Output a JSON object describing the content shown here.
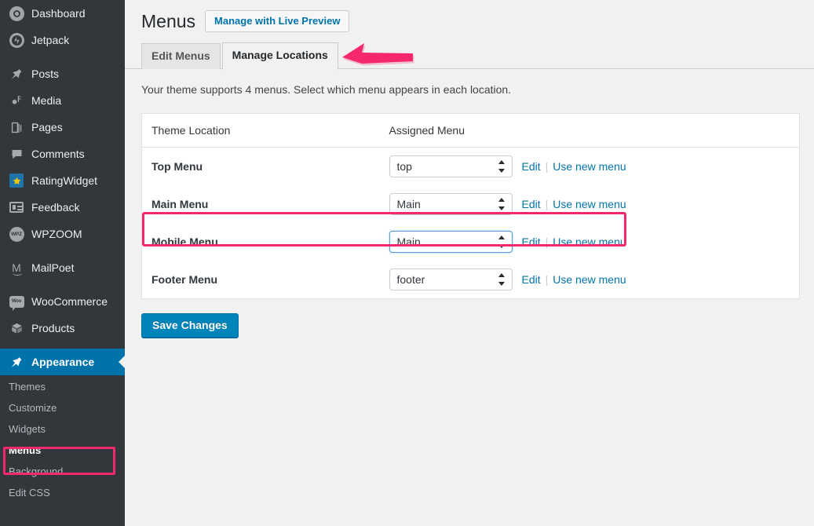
{
  "colors": {
    "sidebar_bg": "#32373c",
    "accent_blue": "#0073aa",
    "highlight_pink": "#f4286b",
    "link_blue": "#0073aa",
    "button_blue": "#0085ba"
  },
  "sidebar": {
    "groups": [
      {
        "items": [
          {
            "label": "Dashboard",
            "icon": "dashboard-icon",
            "glyph": "◔"
          },
          {
            "label": "Jetpack",
            "icon": "jetpack-icon",
            "glyph": "◐"
          }
        ]
      },
      {
        "items": [
          {
            "label": "Posts",
            "icon": "pin-icon",
            "glyph": "✐"
          },
          {
            "label": "Media",
            "icon": "media-icon",
            "glyph": "♪"
          },
          {
            "label": "Pages",
            "icon": "pages-icon",
            "glyph": "❐"
          },
          {
            "label": "Comments",
            "icon": "comment-icon",
            "glyph": "⬛"
          },
          {
            "label": "RatingWidget",
            "icon": "star-icon",
            "glyph": "★"
          },
          {
            "label": "Feedback",
            "icon": "feedback-icon",
            "glyph": ""
          },
          {
            "label": "WPZOOM",
            "icon": "wpzoom-icon",
            "glyph": "WPZ"
          }
        ]
      },
      {
        "items": [
          {
            "label": "MailPoet",
            "icon": "mailpoet-icon",
            "glyph": "M"
          }
        ]
      },
      {
        "items": [
          {
            "label": "WooCommerce",
            "icon": "woocommerce-icon",
            "glyph": "Woo"
          },
          {
            "label": "Products",
            "icon": "products-icon",
            "glyph": "⬡"
          }
        ]
      }
    ],
    "active_item": {
      "label": "Appearance",
      "icon": "appearance-brush-icon",
      "glyph": "✐"
    },
    "submenu": [
      {
        "label": "Themes",
        "current": false
      },
      {
        "label": "Customize",
        "current": false
      },
      {
        "label": "Widgets",
        "current": false
      },
      {
        "label": "Menus",
        "current": true
      },
      {
        "label": "Background",
        "current": false
      },
      {
        "label": "Edit CSS",
        "current": false
      }
    ]
  },
  "header": {
    "page_title": "Menus",
    "live_preview_label": "Manage with Live Preview"
  },
  "tabs": [
    {
      "label": "Edit Menus",
      "active": false
    },
    {
      "label": "Manage Locations",
      "active": true
    }
  ],
  "intro": "Your theme supports 4 menus. Select which menu appears in each location.",
  "table": {
    "columns": [
      "Theme Location",
      "Assigned Menu"
    ],
    "rows": [
      {
        "location": "Top Menu",
        "assigned_menu": "top",
        "edit_label": "Edit",
        "use_new_label": "Use new menu",
        "focused": false,
        "highlighted": false
      },
      {
        "location": "Main Menu",
        "assigned_menu": "Main",
        "edit_label": "Edit",
        "use_new_label": "Use new menu",
        "focused": false,
        "highlighted": false
      },
      {
        "location": "Mobile Menu",
        "assigned_menu": "Main",
        "edit_label": "Edit",
        "use_new_label": "Use new menu",
        "focused": true,
        "highlighted": true
      },
      {
        "location": "Footer Menu",
        "assigned_menu": "footer",
        "edit_label": "Edit",
        "use_new_label": "Use new menu",
        "focused": false,
        "highlighted": false
      }
    ]
  },
  "footer_actions": {
    "save_label": "Save Changes"
  },
  "annotations": {
    "arrow": {
      "name": "pink-arrow-pointing-to-manage-locations-tab",
      "direction": "left",
      "color": "#f4286b"
    },
    "boxes": [
      {
        "name": "mobile-menu-row-highlight",
        "color": "#f4286b"
      },
      {
        "name": "sidebar-menus-highlight",
        "color": "#f4286b"
      }
    ]
  }
}
